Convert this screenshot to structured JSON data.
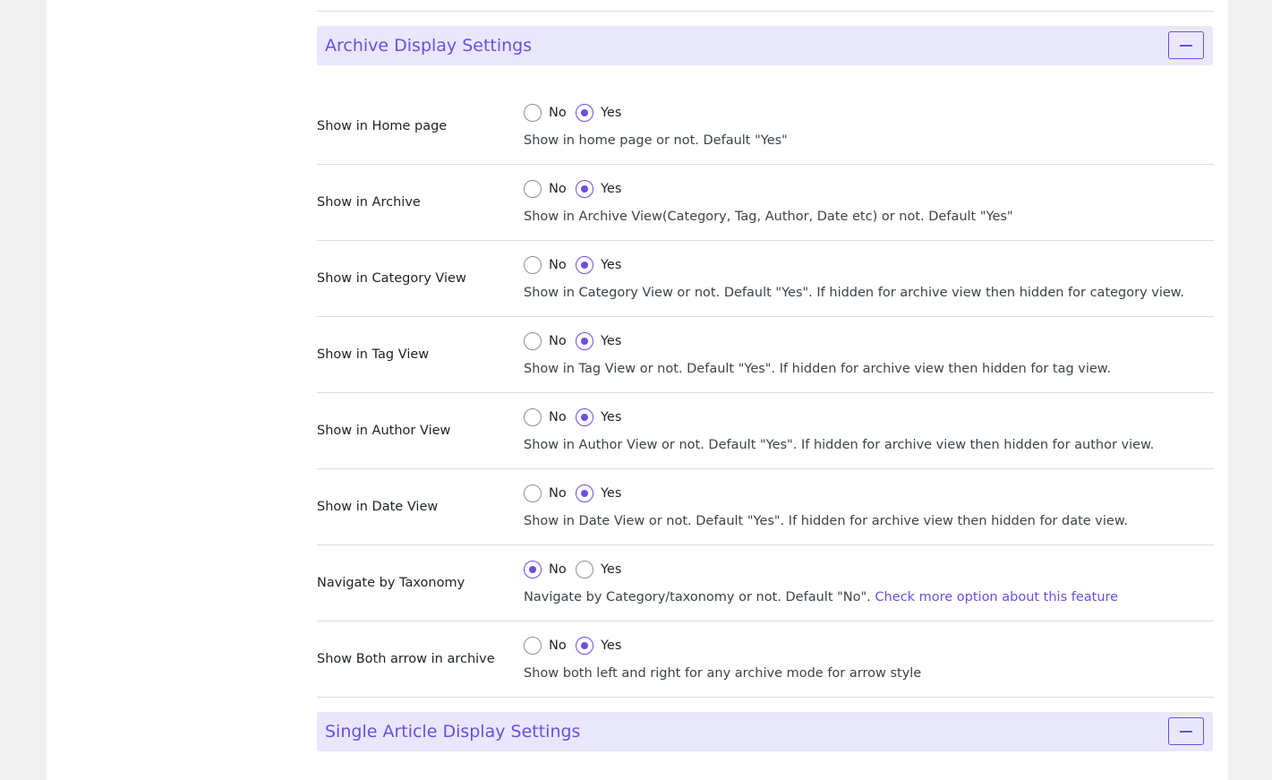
{
  "sections": {
    "archive": {
      "title": "Archive Display Settings",
      "toggle_icon": "minus-icon"
    },
    "single": {
      "title": "Single Article Display Settings",
      "toggle_icon": "minus-icon"
    }
  },
  "colors": {
    "accent": "#6b4fe0",
    "header_bg": "#e9e7fb",
    "page_bg": "#f0f0f1"
  },
  "options": {
    "no": "No",
    "yes": "Yes"
  },
  "rows": [
    {
      "label": "Show in Home page",
      "selected": "yes",
      "help": "Show in home page or not. Default \"Yes\""
    },
    {
      "label": "Show in Archive",
      "selected": "yes",
      "help": "Show in Archive View(Category, Tag, Author, Date etc) or not. Default \"Yes\""
    },
    {
      "label": "Show in Category View",
      "selected": "yes",
      "help": "Show in Category View or not. Default \"Yes\". If hidden for archive view then hidden for category view."
    },
    {
      "label": "Show in Tag View",
      "selected": "yes",
      "help": "Show in Tag View or not. Default \"Yes\". If hidden for archive view then hidden for tag view."
    },
    {
      "label": "Show in Author View",
      "selected": "yes",
      "help": "Show in Author View or not. Default \"Yes\". If hidden for archive view then hidden for author view."
    },
    {
      "label": "Show in Date View",
      "selected": "yes",
      "help": "Show in Date View or not. Default \"Yes\". If hidden for archive view then hidden for date view."
    },
    {
      "label": "Navigate by Taxonomy",
      "selected": "no",
      "help": "Navigate by Category/taxonomy or not. Default \"No\".",
      "link": "Check more option about this feature"
    },
    {
      "label": "Show Both arrow in archive",
      "selected": "yes",
      "help": "Show both left and right for any archive mode for arrow style"
    }
  ]
}
